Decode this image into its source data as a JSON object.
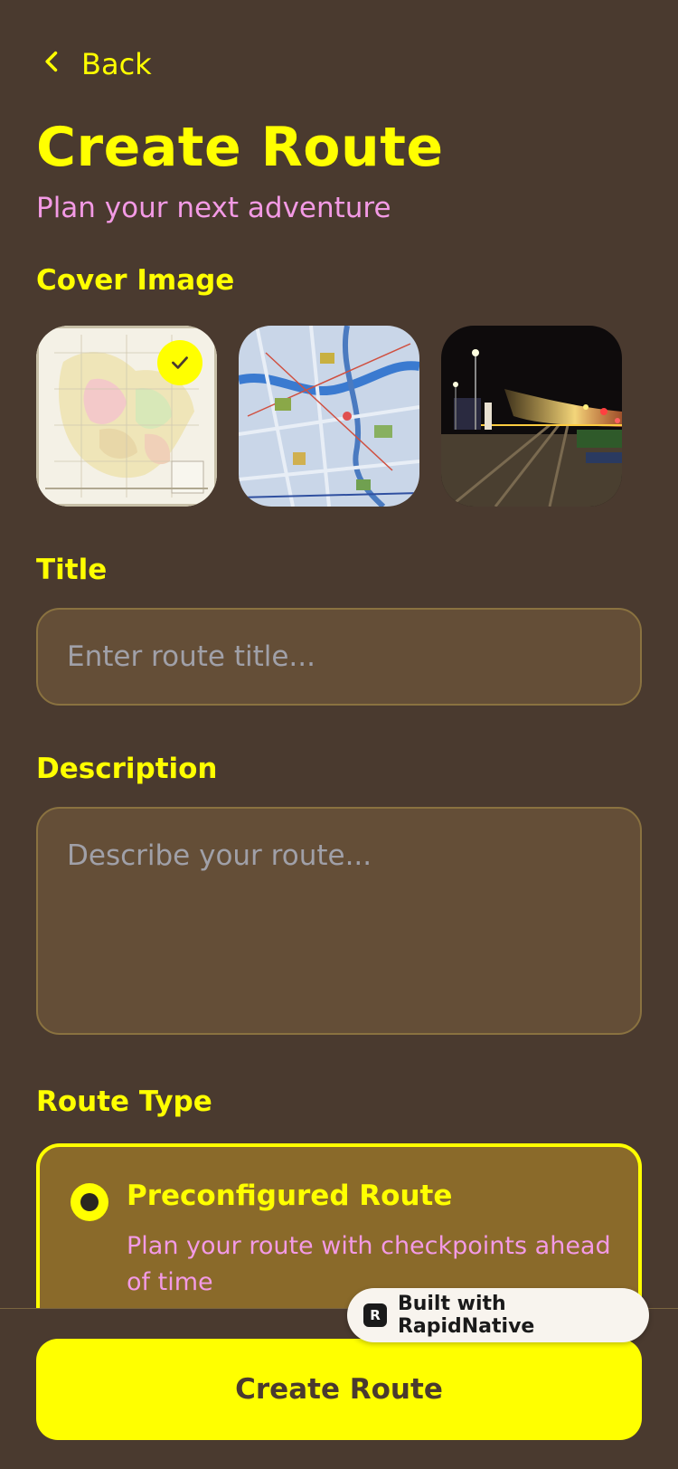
{
  "nav": {
    "back_label": "Back"
  },
  "header": {
    "title": "Create Route",
    "subtitle": "Plan your next adventure"
  },
  "cover_image": {
    "label": "Cover Image",
    "options": [
      {
        "icon": "europe-map-image",
        "selected": true
      },
      {
        "icon": "city-map-image",
        "selected": false
      },
      {
        "icon": "night-tram-street-image",
        "selected": false
      }
    ]
  },
  "title_field": {
    "label": "Title",
    "placeholder": "Enter route title..."
  },
  "description_field": {
    "label": "Description",
    "placeholder": "Describe your route..."
  },
  "route_type": {
    "label": "Route Type",
    "options": [
      {
        "title": "Preconfigured Route",
        "description": "Plan your route with checkpoints ahead of time",
        "selected": true
      }
    ]
  },
  "actions": {
    "create_label": "Create Route"
  },
  "badge": {
    "logo": "R",
    "label": "Built with RapidNative"
  },
  "colors": {
    "background": "#4a3a2f",
    "accent": "#ffff00",
    "secondary_text": "#f39ae5",
    "input_bg": "#644e37",
    "selected_card_bg": "#8a6a2a"
  }
}
